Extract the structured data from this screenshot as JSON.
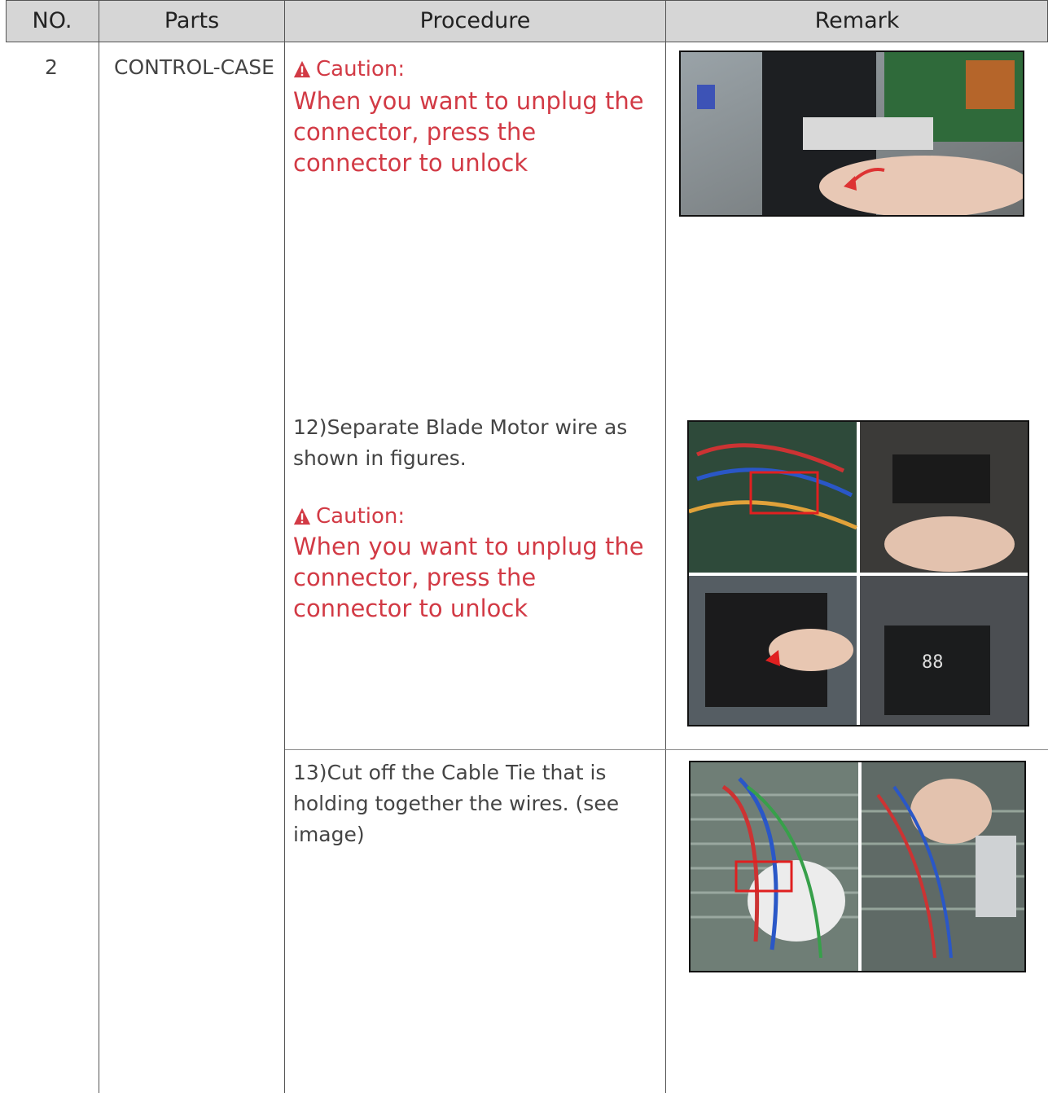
{
  "table": {
    "headers": {
      "no": "NO.",
      "parts": "Parts",
      "procedure": "Procedure",
      "remark": "Remark"
    },
    "no": "2",
    "parts": "CONTROL-CASE"
  },
  "rows": [
    {
      "step": "",
      "caution_label": "Caution:",
      "caution_text": "When you want to unplug the connector, press the connector to unlock"
    },
    {
      "step": "12)Separate Blade Motor wire as shown in figures.",
      "caution_label": "Caution:",
      "caution_text": "When you want to unplug the connector, press the connector to unlock"
    },
    {
      "step": "13)Cut off the Cable Tie that is holding together the wires. (see image)"
    }
  ],
  "colors": {
    "header_bg": "#d6d6d6",
    "caution": "#d23a45",
    "line": "#555555"
  }
}
